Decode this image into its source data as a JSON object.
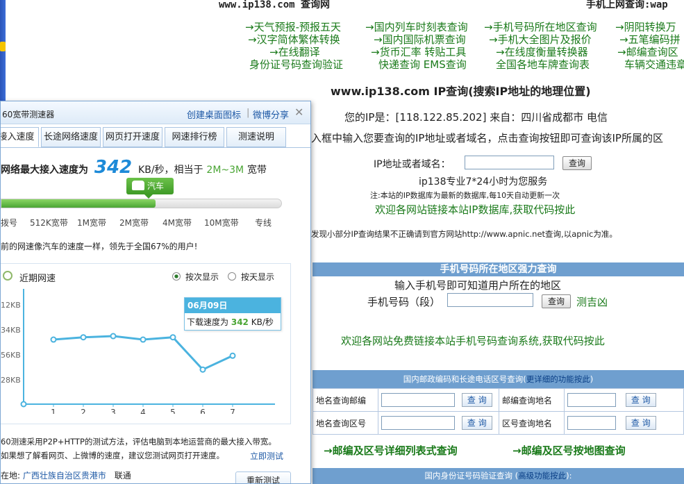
{
  "header": {
    "left": "www.ip138.com 查询网",
    "right": "手机上网查询:wap"
  },
  "links": {
    "row1": [
      "→天气预报-预报五天",
      "→国内列车时刻表查询",
      "→手机号码所在地区查询",
      "→阴阳转换万"
    ],
    "row2": [
      "→汉字简体繁体转换",
      "→国内国际机票查询",
      "→手机大全图片及报价",
      "→五笔编码拼"
    ],
    "row3": [
      "→在线翻译",
      "→货币汇率 转贴工具",
      "→在线度衡量转换器",
      "→邮编查询区"
    ],
    "row4": [
      "身份证号码查询验证",
      "快递查询 EMS查询",
      "全国各地车牌查询表",
      "车辆交通违章"
    ]
  },
  "ip_section": {
    "title": "www.ip138.com IP查询(搜索IP地址的地理位置)",
    "your_ip": "您的IP是：[118.122.85.202] 来自：四川省成都市 电信",
    "instruction": "入框中输入您要查询的IP地址或者域名，点击查询按钮即可查询该IP所属的区",
    "input_label": "IP地址或者域名：",
    "query_button": "查询",
    "service": "ip138专业7*24小时为您服务",
    "note": "注:本站的IP数据库为最新的数据库,每10天自动更新一次",
    "welcome": "欢迎各网站链接本站IP数据库,获取代码按此",
    "apnic": "发现小部分IP查询结果不正确请到官方网站http://www.apnic.net查询,以apnic为准。"
  },
  "mobile_section": {
    "bar": "手机号码所在地区强力查询",
    "subtitle": "输入手机号即可知道用户所在的地区",
    "label": "手机号码（段）",
    "query_button": "查询",
    "extra": "测吉凶",
    "welcome": "欢迎各网站免费链接本站手机号码查询系统,获取代码按此"
  },
  "postal_section": {
    "bar": "国内邮政编码和长途电话区号查询(",
    "bar_link": "更详细的功能按此",
    "bar_end": ")",
    "rows": [
      {
        "l1": "地名查询邮编",
        "l2": "邮编查询地名"
      },
      {
        "l1": "地名查询区号",
        "l2": "区号查询地名"
      }
    ],
    "query_button": "查 询",
    "link1": "→邮编及区号详细列表式查询",
    "link2": "→邮编及区号按地图查询",
    "id_bar": "国内身份证号码验证查询 (",
    "id_bar_link": "高级功能按此",
    "id_bar_end": "):"
  },
  "widget": {
    "title": "60宽带测速器",
    "create_icon": "创建桌面图标",
    "sep": "|",
    "share": "微博分享",
    "tabs": [
      "接入速度",
      "长途网络速度",
      "网页打开速度",
      "网速排行榜",
      "测速说明"
    ],
    "speed_prefix": "网络最大接入速度为",
    "speed_value": "342",
    "speed_unit": "KB/秒，相当于",
    "speed_equiv": "2M~3M",
    "speed_suffix": "宽带",
    "vehicle": "汽车",
    "progress": 0.55,
    "ticks": [
      "拨号",
      "512K宽带",
      "1M宽带",
      "2M宽带",
      "4M宽带",
      "10M宽带",
      "专线"
    ],
    "compare": "前的网速像汽车的速度一样，领先于全国67%的用户!",
    "recent": "近期网速",
    "radio1": "按次显示",
    "radio2": "按天显示",
    "ylabels": [
      "12KB",
      "34KB",
      "56KB",
      "28KB"
    ],
    "tooltip_date": "06月09日",
    "tooltip_prefix": "下载速度为",
    "tooltip_value": "342",
    "tooltip_unit": "KB/秒",
    "foot1": "60测速采用P2P+HTTP的测试方法，评估电脑到本地运营商的最大接入带宽。",
    "foot2": "如果想了解看网页、上微博的速度，建议您测试网页打开速度。",
    "foot_link": "立即测试",
    "location_label": "在地:",
    "location": "广西壮族自治区贵港市",
    "isp": "联通",
    "retest": "重新测试"
  },
  "chart_data": {
    "type": "line",
    "x": [
      1,
      2,
      3,
      4,
      5,
      6,
      7
    ],
    "y": [
      0.56,
      0.58,
      0.59,
      0.56,
      0.58,
      0.3,
      0.42
    ],
    "series": [
      {
        "values": [
          0.56,
          0.58,
          0.59,
          0.56,
          0.58,
          0.3,
          0.42
        ]
      }
    ],
    "xlabel": "",
    "ylabel": "",
    "grid": false
  },
  "colors": {
    "link_green": "#1a7a1a",
    "bar_blue": "#6f9fcf",
    "widget_blue": "#1d58a5",
    "speed_green": "#4aa534",
    "chart_line": "#4bb3df"
  }
}
